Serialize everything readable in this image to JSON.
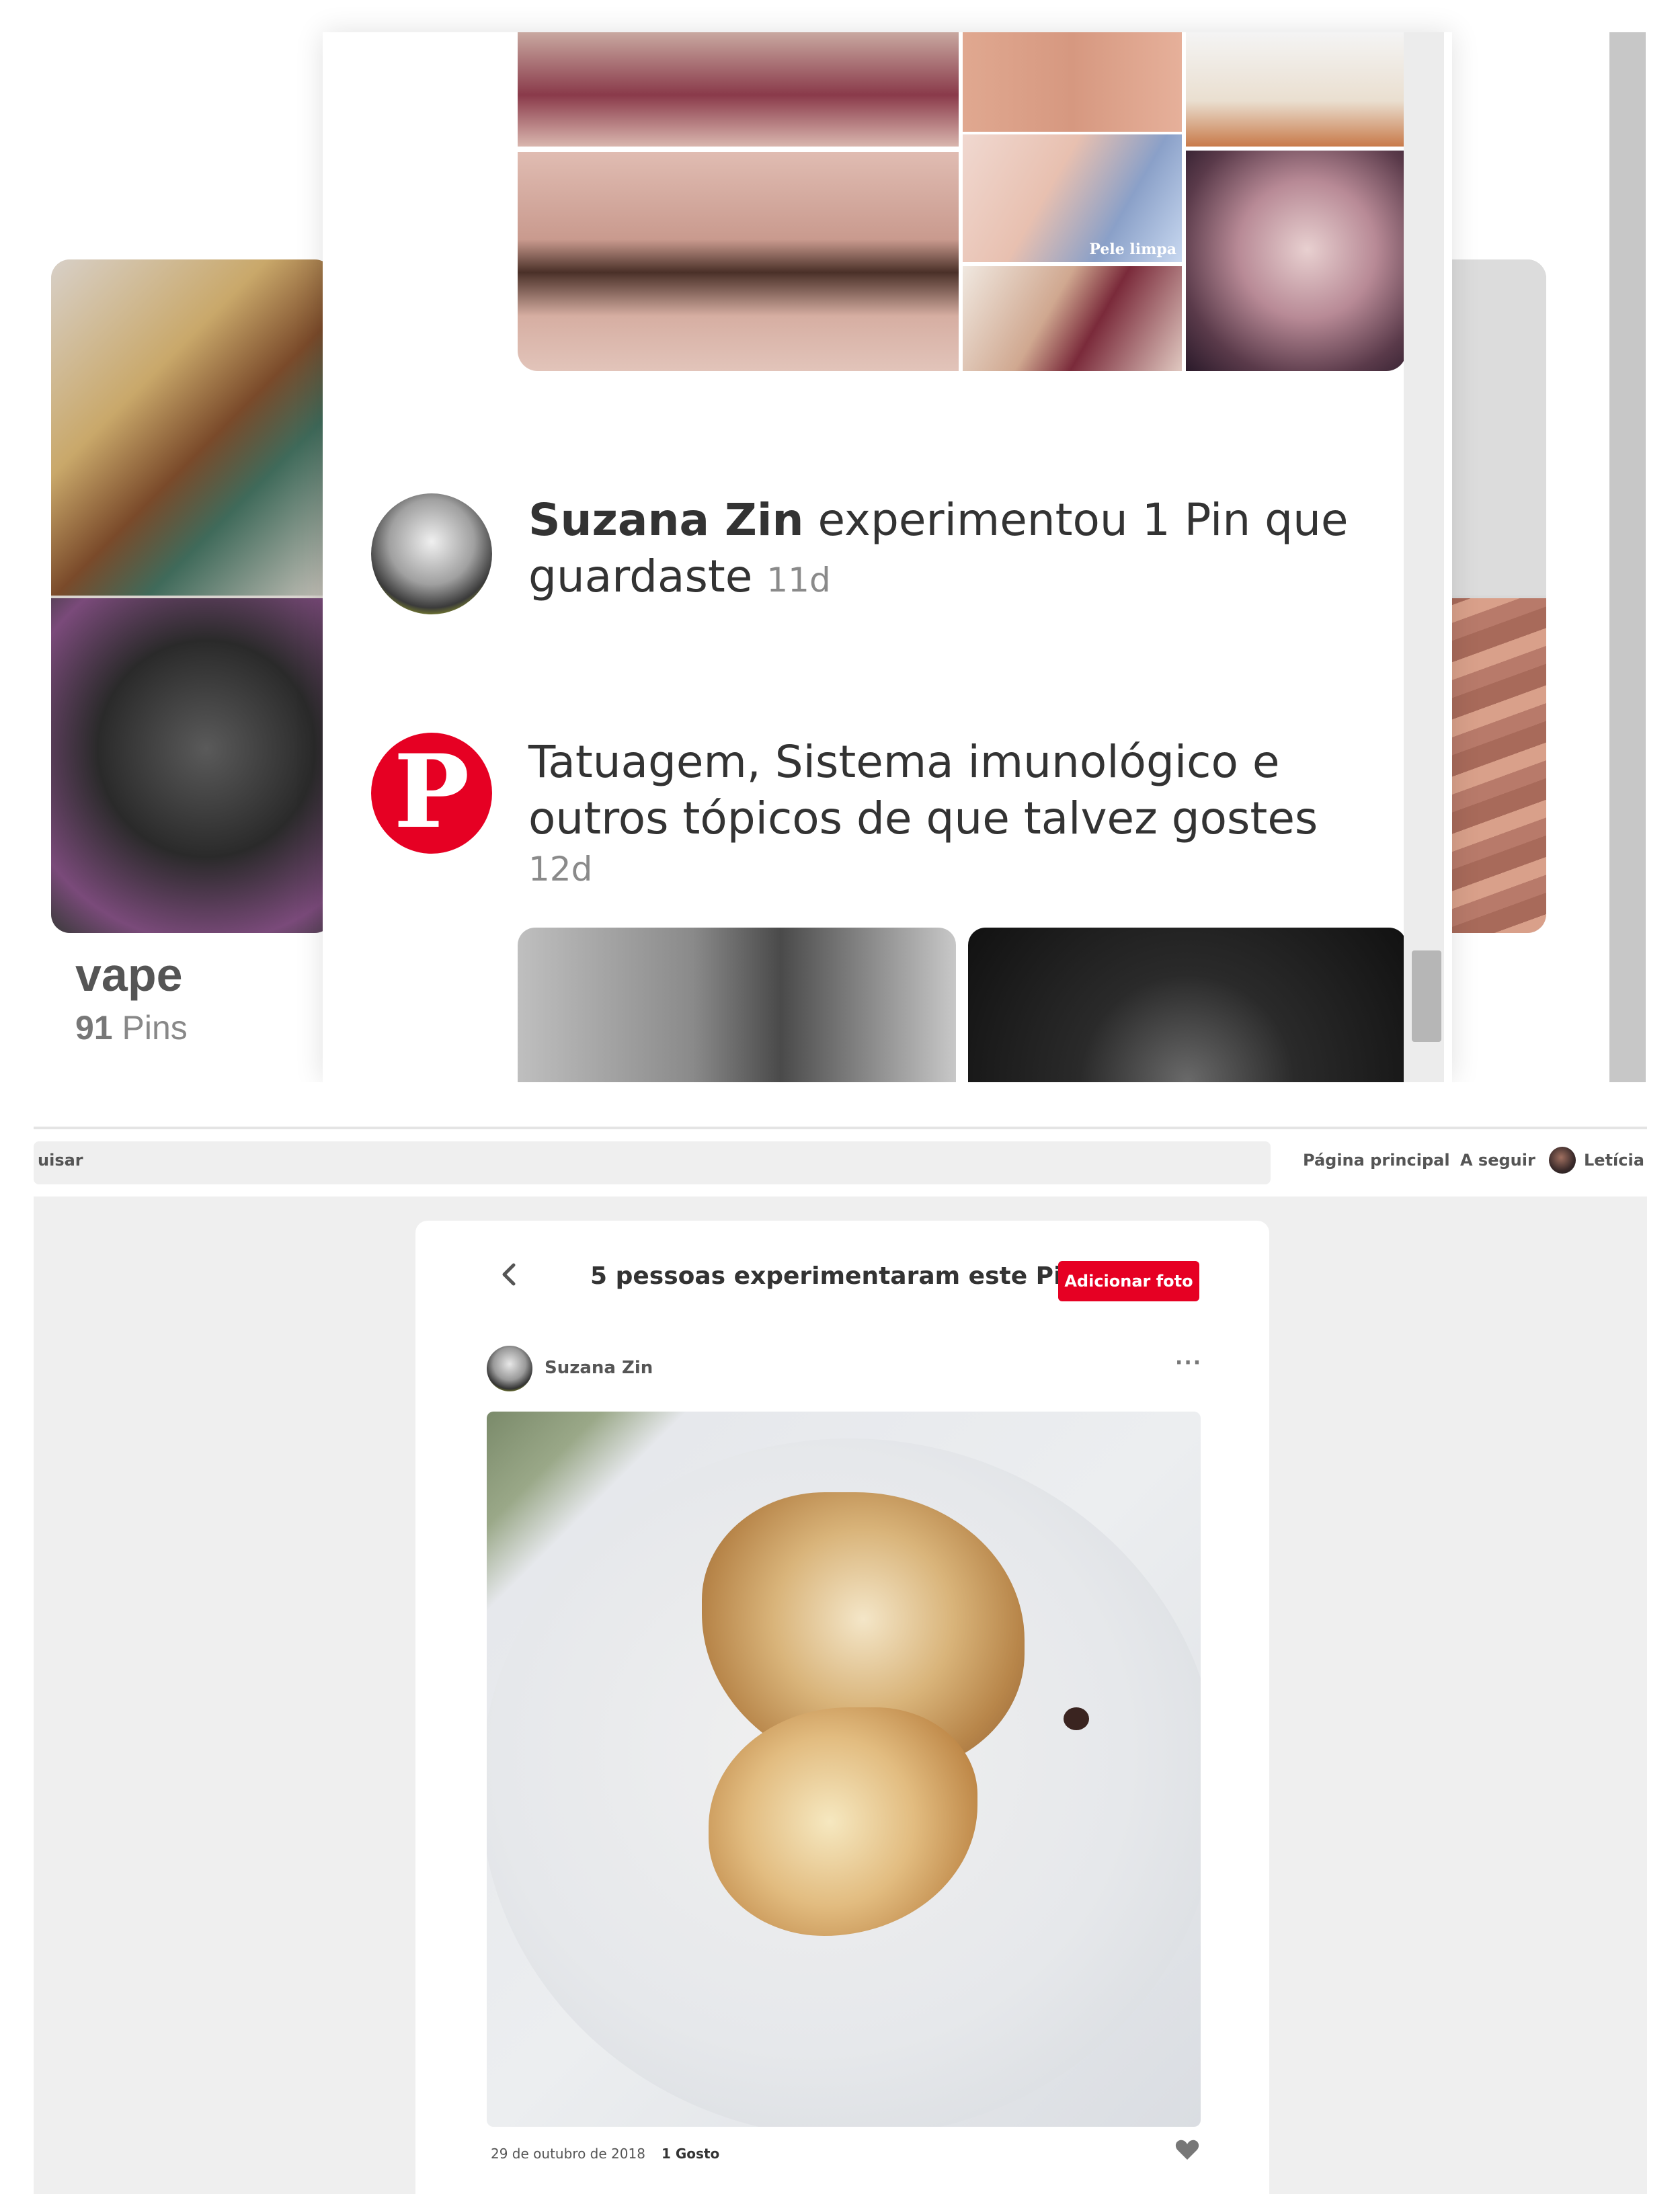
{
  "top": {
    "board": {
      "title": "vape",
      "count_number": "91",
      "count_label": "Pins"
    },
    "image_label": "Pele limpa",
    "notifications": [
      {
        "user": "Suzana Zin",
        "text": "experimentou 1 Pin que guardaste",
        "time": "11d"
      },
      {
        "text": "Tatuagem, Sistema imunológico e outros tópicos de que talvez gostes",
        "time": "12d"
      }
    ]
  },
  "header": {
    "search_partial": "uisar",
    "nav_home": "Página principal",
    "nav_following": "A seguir",
    "user_name": "Letícia"
  },
  "card": {
    "title": "5 pessoas experimentaram este Pin",
    "add_photo": "Adicionar foto",
    "post": {
      "author": "Suzana Zin",
      "more": "···",
      "date": "29 de outubro de 2018",
      "likes": "1 Gosto"
    }
  },
  "colors": {
    "accent": "#e60023"
  },
  "icons": [
    "pinterest-logo-icon",
    "back-arrow-icon",
    "more-options-icon",
    "heart-icon"
  ]
}
